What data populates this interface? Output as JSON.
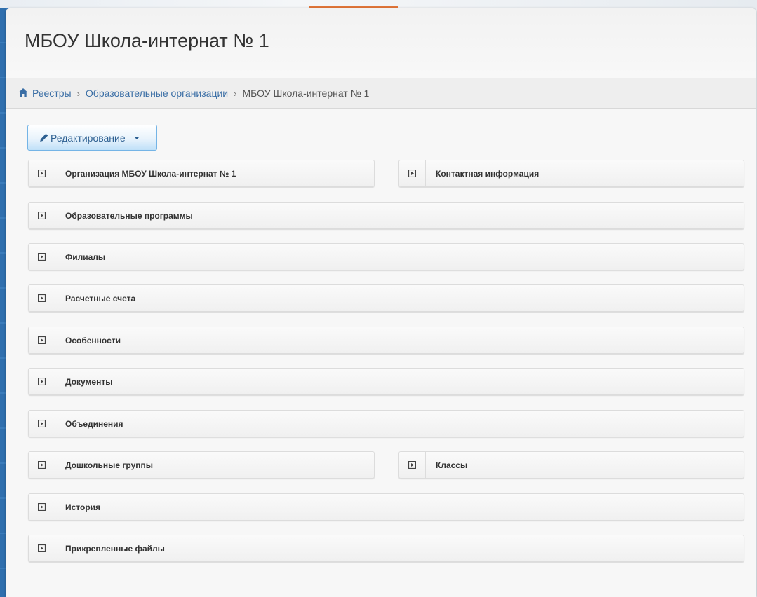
{
  "page": {
    "title": "МБОУ Школа-интернат № 1"
  },
  "breadcrumb": {
    "items": [
      "Реестры",
      "Образовательные организации"
    ],
    "current": "МБОУ Школа-интернат № 1",
    "separator": "›"
  },
  "toolbar": {
    "edit_label": "Редактирование"
  },
  "sections": [
    {
      "label": "Организация МБОУ Школа-интернат № 1"
    },
    {
      "label": "Контактная информация"
    },
    {
      "label": "Образовательные программы"
    },
    {
      "label": "Филиалы"
    },
    {
      "label": "Расчетные счета"
    },
    {
      "label": "Особенности"
    },
    {
      "label": "Документы"
    },
    {
      "label": "Объединения"
    },
    {
      "label": "Дошкольные группы"
    },
    {
      "label": "Классы"
    },
    {
      "label": "История"
    },
    {
      "label": "Прикрепленные файлы"
    }
  ],
  "colors": {
    "accent": "#e2763a",
    "link": "#3a6ea5",
    "frame": "#3d7fbf"
  },
  "icons": {
    "home": "home-icon",
    "pencil": "pencil-icon",
    "caret": "caret-down-icon",
    "expand": "expand-square-icon"
  }
}
